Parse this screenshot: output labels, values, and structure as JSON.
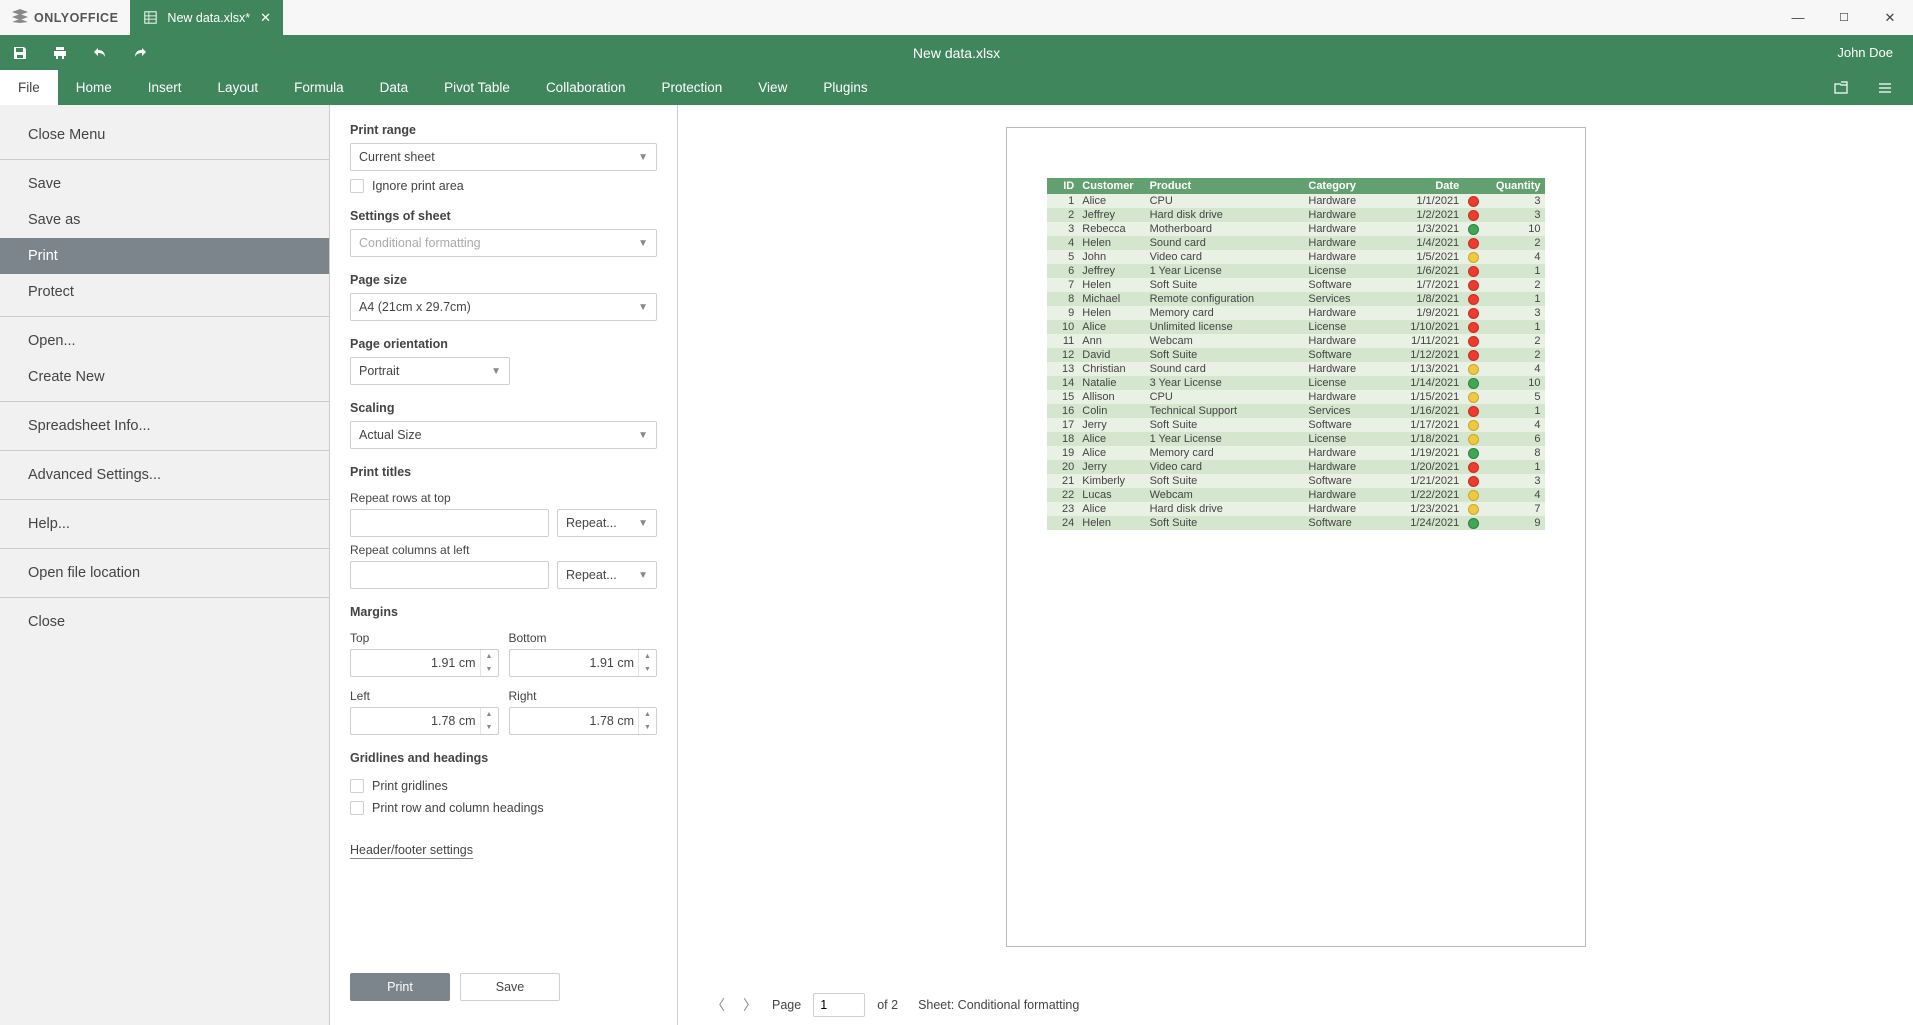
{
  "app": {
    "brand": "ONLYOFFICE",
    "tab_title": "New data.xlsx*",
    "center_title": "New data.xlsx",
    "user": "John Doe"
  },
  "menutabs": [
    "File",
    "Home",
    "Insert",
    "Layout",
    "Formula",
    "Data",
    "Pivot Table",
    "Collaboration",
    "Protection",
    "View",
    "Plugins"
  ],
  "menutabs_active_index": 0,
  "sidemenu": {
    "items": [
      {
        "label": "Close Menu",
        "type": "item"
      },
      {
        "type": "sep"
      },
      {
        "label": "Save",
        "type": "item"
      },
      {
        "label": "Save as",
        "type": "item"
      },
      {
        "label": "Print",
        "type": "item",
        "selected": true
      },
      {
        "label": "Protect",
        "type": "item"
      },
      {
        "type": "sep"
      },
      {
        "label": "Open...",
        "type": "item"
      },
      {
        "label": "Create New",
        "type": "item"
      },
      {
        "type": "sep"
      },
      {
        "label": "Spreadsheet Info...",
        "type": "item"
      },
      {
        "type": "sep"
      },
      {
        "label": "Advanced Settings...",
        "type": "item"
      },
      {
        "type": "sep"
      },
      {
        "label": "Help...",
        "type": "item"
      },
      {
        "type": "sep"
      },
      {
        "label": "Open file location",
        "type": "item"
      },
      {
        "type": "sep"
      },
      {
        "label": "Close",
        "type": "item"
      }
    ]
  },
  "settings": {
    "print_range_title": "Print range",
    "print_range_value": "Current sheet",
    "ignore_print_area": "Ignore print area",
    "settings_of_sheet_title": "Settings of sheet",
    "settings_of_sheet_value": "Conditional formatting",
    "page_size_title": "Page size",
    "page_size_value": "A4 (21cm x 29.7cm)",
    "page_orientation_title": "Page orientation",
    "page_orientation_value": "Portrait",
    "scaling_title": "Scaling",
    "scaling_value": "Actual Size",
    "print_titles_title": "Print titles",
    "repeat_rows_label": "Repeat rows at top",
    "repeat_cols_label": "Repeat columns at left",
    "repeat_btn": "Repeat...",
    "margins_title": "Margins",
    "margin_top_label": "Top",
    "margin_bottom_label": "Bottom",
    "margin_left_label": "Left",
    "margin_right_label": "Right",
    "margin_top": "1.91 cm",
    "margin_bottom": "1.91 cm",
    "margin_left": "1.78 cm",
    "margin_right": "1.78 cm",
    "gridlines_title": "Gridlines and headings",
    "print_gridlines": "Print gridlines",
    "print_headings": "Print row and column headings",
    "header_footer": "Header/footer settings",
    "print_btn": "Print",
    "save_btn": "Save"
  },
  "preview": {
    "page_label": "Page",
    "page_num": "1",
    "page_total": "of 2",
    "sheet_label": "Sheet: Conditional formatting",
    "headers": [
      "ID",
      "Customer",
      "Product",
      "Category",
      "Date",
      "Quantity"
    ],
    "rows": [
      {
        "id": 1,
        "customer": "Alice",
        "product": "CPU",
        "category": "Hardware",
        "date": "1/1/2021",
        "dot": "red",
        "qty": 3
      },
      {
        "id": 2,
        "customer": "Jeffrey",
        "product": "Hard disk drive",
        "category": "Hardware",
        "date": "1/2/2021",
        "dot": "red",
        "qty": 3
      },
      {
        "id": 3,
        "customer": "Rebecca",
        "product": "Motherboard",
        "category": "Hardware",
        "date": "1/3/2021",
        "dot": "green",
        "qty": 10
      },
      {
        "id": 4,
        "customer": "Helen",
        "product": "Sound card",
        "category": "Hardware",
        "date": "1/4/2021",
        "dot": "red",
        "qty": 2
      },
      {
        "id": 5,
        "customer": "John",
        "product": "Video card",
        "category": "Hardware",
        "date": "1/5/2021",
        "dot": "yellow",
        "qty": 4
      },
      {
        "id": 6,
        "customer": "Jeffrey",
        "product": "1 Year License",
        "category": "License",
        "date": "1/6/2021",
        "dot": "red",
        "qty": 1
      },
      {
        "id": 7,
        "customer": "Helen",
        "product": "Soft Suite",
        "category": "Software",
        "date": "1/7/2021",
        "dot": "red",
        "qty": 2
      },
      {
        "id": 8,
        "customer": "Michael",
        "product": "Remote configuration",
        "category": "Services",
        "date": "1/8/2021",
        "dot": "red",
        "qty": 1
      },
      {
        "id": 9,
        "customer": "Helen",
        "product": "Memory card",
        "category": "Hardware",
        "date": "1/9/2021",
        "dot": "red",
        "qty": 3
      },
      {
        "id": 10,
        "customer": "Alice",
        "product": "Unlimited license",
        "category": "License",
        "date": "1/10/2021",
        "dot": "red",
        "qty": 1
      },
      {
        "id": 11,
        "customer": "Ann",
        "product": "Webcam",
        "category": "Hardware",
        "date": "1/11/2021",
        "dot": "red",
        "qty": 2
      },
      {
        "id": 12,
        "customer": "David",
        "product": "Soft Suite",
        "category": "Software",
        "date": "1/12/2021",
        "dot": "red",
        "qty": 2
      },
      {
        "id": 13,
        "customer": "Christian",
        "product": "Sound card",
        "category": "Hardware",
        "date": "1/13/2021",
        "dot": "yellow",
        "qty": 4
      },
      {
        "id": 14,
        "customer": "Natalie",
        "product": "3 Year License",
        "category": "License",
        "date": "1/14/2021",
        "dot": "green",
        "qty": 10
      },
      {
        "id": 15,
        "customer": "Allison",
        "product": "CPU",
        "category": "Hardware",
        "date": "1/15/2021",
        "dot": "yellow",
        "qty": 5
      },
      {
        "id": 16,
        "customer": "Colin",
        "product": "Technical Support",
        "category": "Services",
        "date": "1/16/2021",
        "dot": "red",
        "qty": 1
      },
      {
        "id": 17,
        "customer": "Jerry",
        "product": "Soft Suite",
        "category": "Software",
        "date": "1/17/2021",
        "dot": "yellow",
        "qty": 4
      },
      {
        "id": 18,
        "customer": "Alice",
        "product": "1 Year License",
        "category": "License",
        "date": "1/18/2021",
        "dot": "yellow",
        "qty": 6
      },
      {
        "id": 19,
        "customer": "Alice",
        "product": "Memory card",
        "category": "Hardware",
        "date": "1/19/2021",
        "dot": "green",
        "qty": 8
      },
      {
        "id": 20,
        "customer": "Jerry",
        "product": "Video card",
        "category": "Hardware",
        "date": "1/20/2021",
        "dot": "red",
        "qty": 1
      },
      {
        "id": 21,
        "customer": "Kimberly",
        "product": "Soft Suite",
        "category": "Software",
        "date": "1/21/2021",
        "dot": "red",
        "qty": 3
      },
      {
        "id": 22,
        "customer": "Lucas",
        "product": "Webcam",
        "category": "Hardware",
        "date": "1/22/2021",
        "dot": "yellow",
        "qty": 4
      },
      {
        "id": 23,
        "customer": "Alice",
        "product": "Hard disk drive",
        "category": "Hardware",
        "date": "1/23/2021",
        "dot": "yellow",
        "qty": 7
      },
      {
        "id": 24,
        "customer": "Helen",
        "product": "Soft Suite",
        "category": "Software",
        "date": "1/24/2021",
        "dot": "green",
        "qty": 9
      }
    ]
  }
}
